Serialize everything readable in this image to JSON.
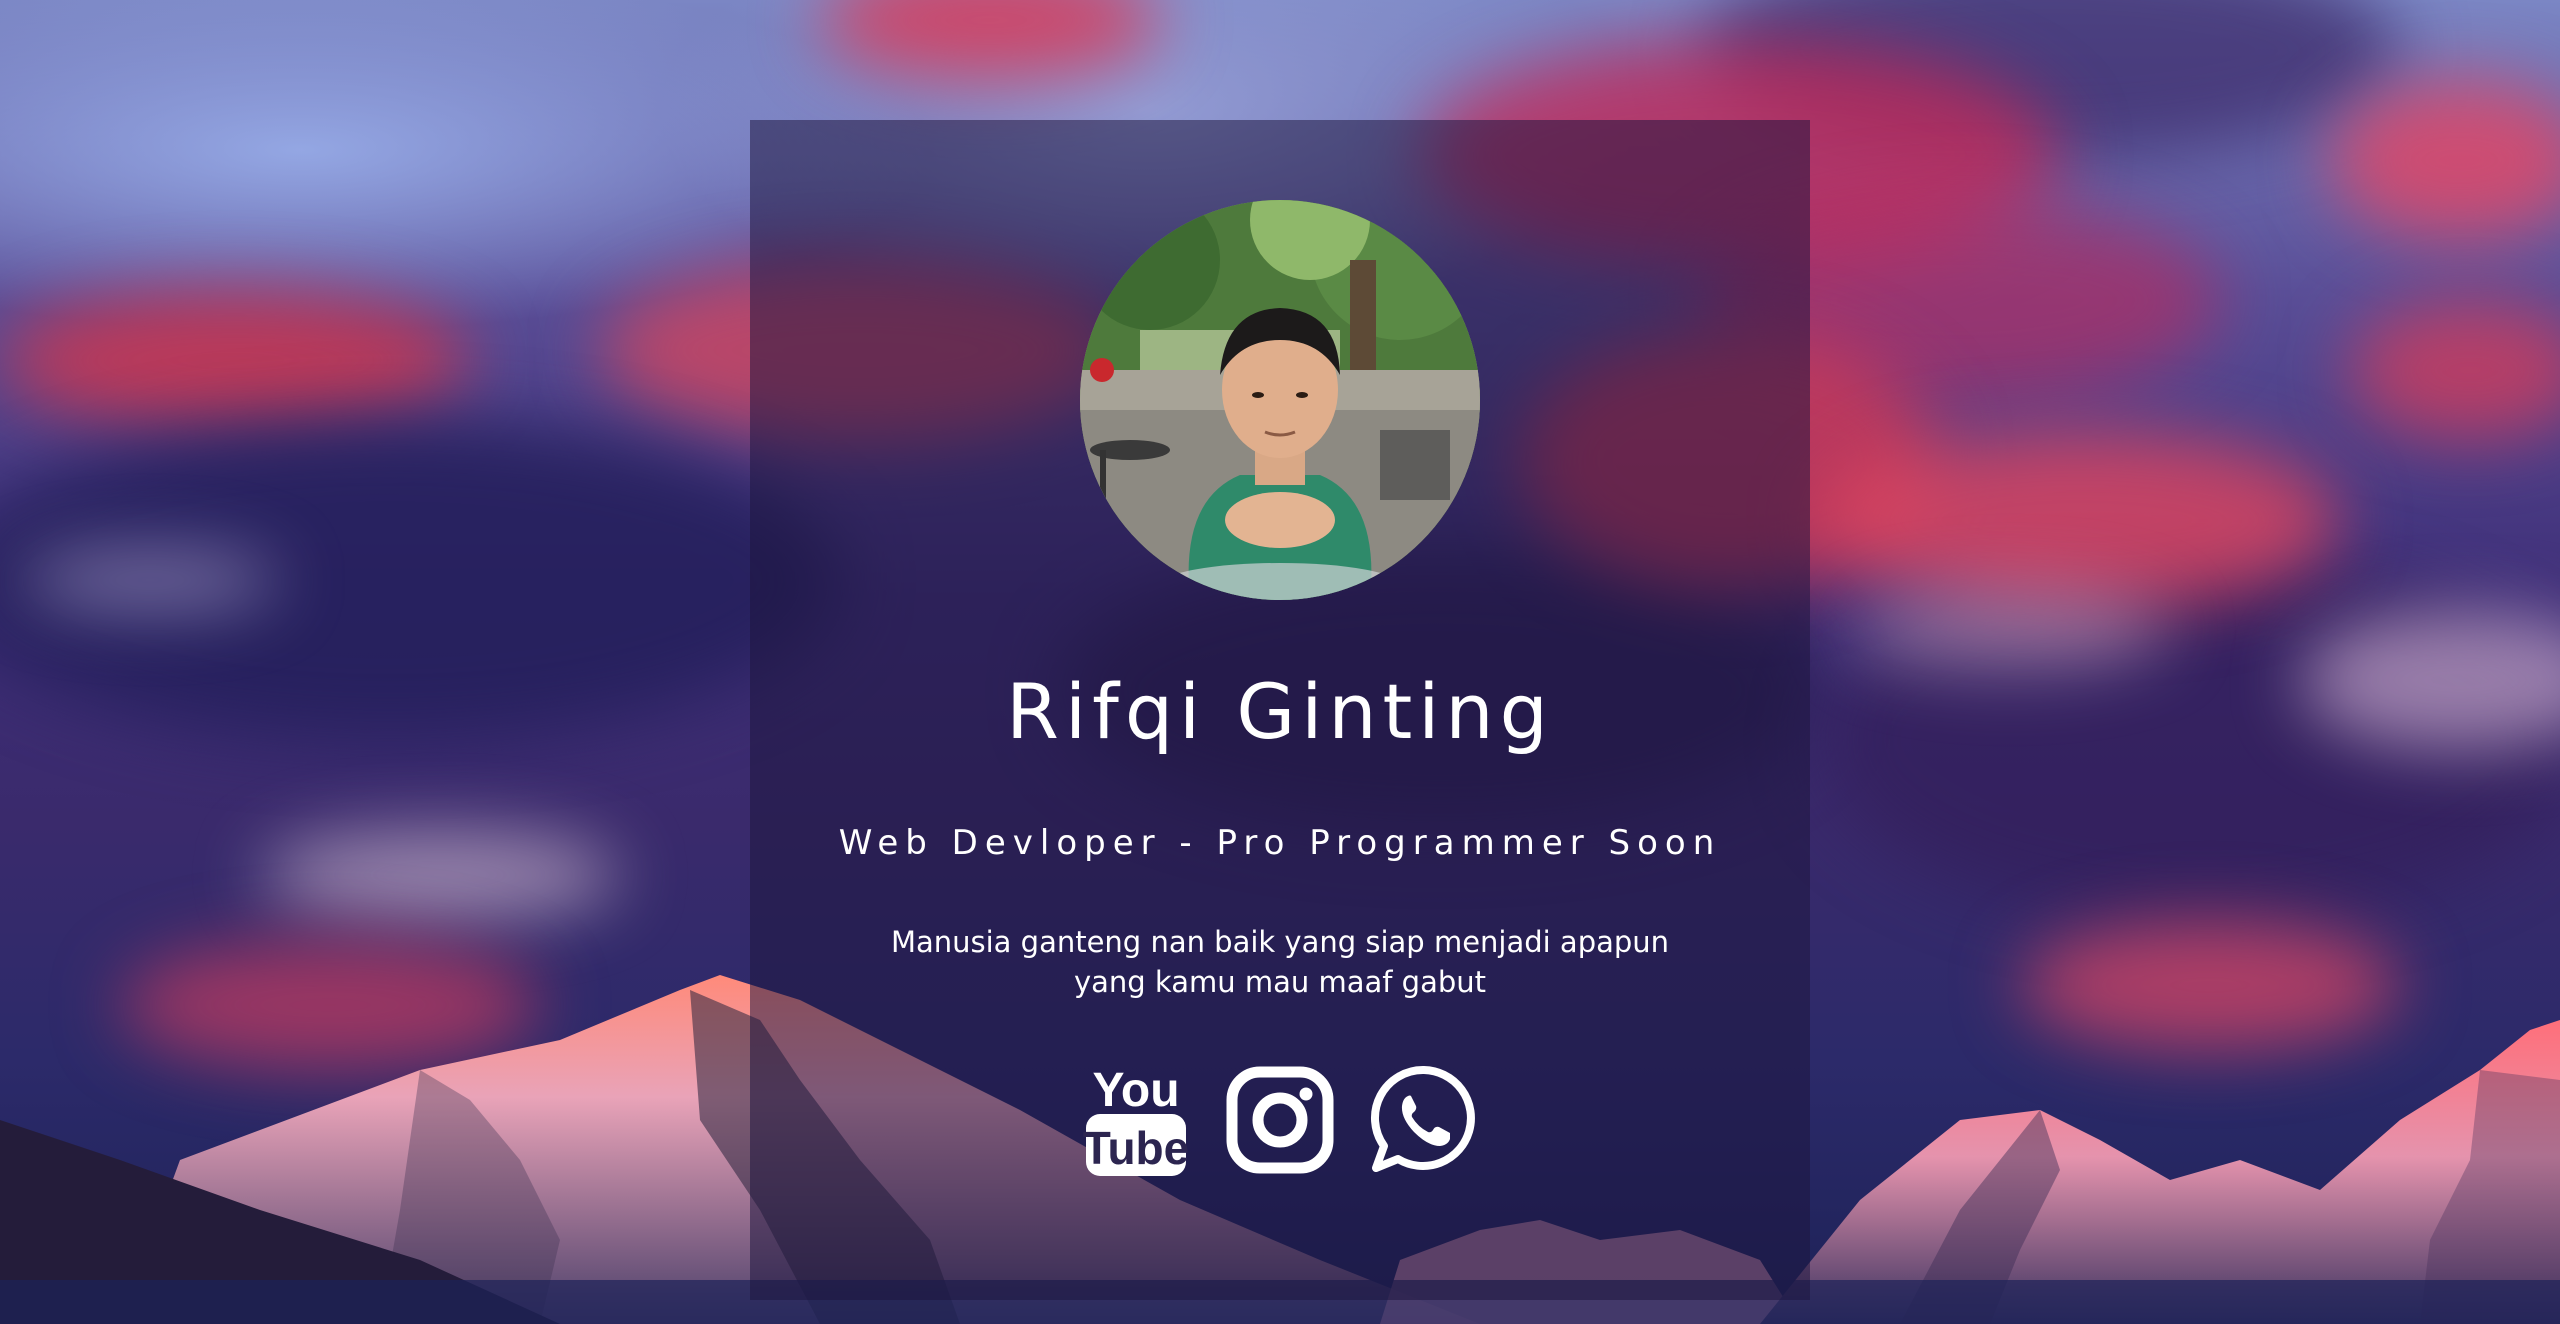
{
  "profile": {
    "name": "Rifqi Ginting",
    "role": "Web Devloper - Pro Programmer Soon",
    "bio_line1": "Manusia ganteng nan baik yang siap menjadi apapun",
    "bio_line2": "yang kamu mau maaf gabut"
  },
  "socials": [
    {
      "name": "YouTube",
      "icon": "youtube-icon",
      "logo_text_top": "You",
      "logo_text_bottom": "Tube"
    },
    {
      "name": "Instagram",
      "icon": "instagram-icon"
    },
    {
      "name": "WhatsApp",
      "icon": "whatsapp-icon"
    }
  ],
  "colors": {
    "text": "#ffffff",
    "card_overlay": "rgba(28,22,62,0.52)",
    "sky_accent": "#d8366a"
  }
}
